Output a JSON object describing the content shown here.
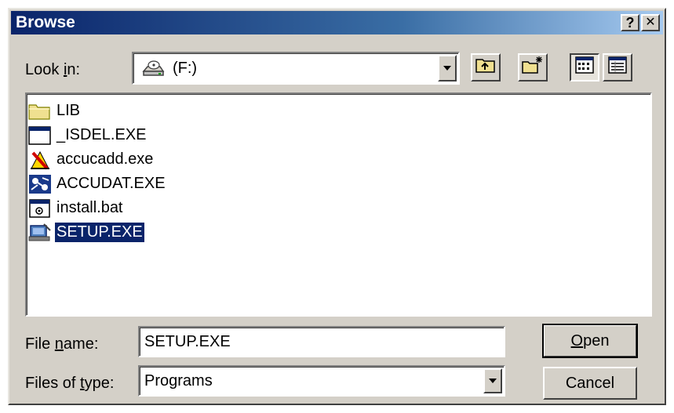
{
  "window": {
    "title": "Browse"
  },
  "titlebar": {
    "help_label": "?",
    "close_label": "✕"
  },
  "toolbar": {
    "look_in_label_pre": "Look ",
    "look_in_label_key": "i",
    "look_in_label_post": "n:",
    "look_in_value": "(F:)"
  },
  "files": [
    {
      "name": "LIB",
      "icon": "folder-icon"
    },
    {
      "name": "_ISDEL.EXE",
      "icon": "window-app-icon"
    },
    {
      "name": "accucadd.exe",
      "icon": "accucadd-icon"
    },
    {
      "name": "ACCUDAT.EXE",
      "icon": "accudat-icon"
    },
    {
      "name": "install.bat",
      "icon": "batch-file-icon"
    },
    {
      "name": "SETUP.EXE",
      "icon": "setup-icon",
      "selected": true
    }
  ],
  "filename": {
    "label_pre": "File ",
    "label_key": "n",
    "label_post": "ame:",
    "value": "SETUP.EXE"
  },
  "filetype": {
    "label_pre": "Files of ",
    "label_key": "t",
    "label_post": "ype:",
    "value": "Programs"
  },
  "buttons": {
    "open_key": "O",
    "open_rest": "pen",
    "cancel_label": "Cancel"
  },
  "colors": {
    "titlebar": "#0a246a",
    "selection": "#0a246a",
    "face": "#d4d0c8"
  }
}
